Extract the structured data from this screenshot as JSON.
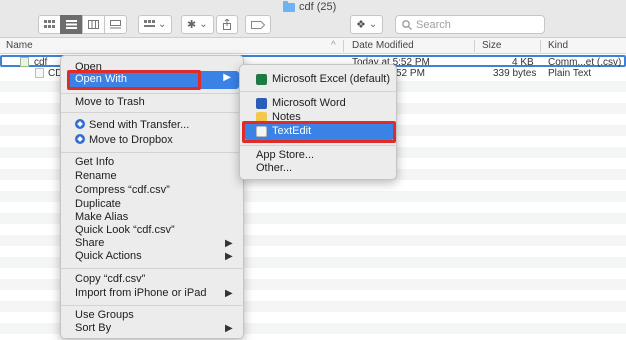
{
  "window": {
    "title": "cdf (25)"
  },
  "toolbar": {
    "view_icons": [
      "icon-view-icon",
      "list-view-icon",
      "column-view-icon",
      "gallery-view-icon"
    ],
    "group_caret": "⌄",
    "action_caret": "⌄",
    "dropbox_caret": "⌄",
    "search_placeholder": "Search"
  },
  "columns": {
    "name": "Name",
    "date": "Date Modified",
    "size": "Size",
    "kind": "Kind"
  },
  "files": [
    {
      "name": "cdf",
      "date": "Today at 5:52 PM",
      "size": "4 KB",
      "kind": "Comm...et (.csv)"
    },
    {
      "name": "CD",
      "date": "52 PM",
      "size": "339 bytes",
      "kind": "Plain Text"
    }
  ],
  "context_menu": {
    "open": "Open",
    "open_with": "Open With",
    "move_to_trash": "Move to Trash",
    "send_with_transfer": "Send with Transfer...",
    "move_to_dropbox": "Move to Dropbox",
    "get_info": "Get Info",
    "rename": "Rename",
    "compress": "Compress “cdf.csv”",
    "duplicate": "Duplicate",
    "make_alias": "Make Alias",
    "quick_look": "Quick Look “cdf.csv”",
    "share": "Share",
    "quick_actions": "Quick Actions",
    "copy": "Copy “cdf.csv”",
    "import_iphone": "Import from iPhone or iPad",
    "use_groups": "Use Groups",
    "sort_by": "Sort By"
  },
  "open_with_menu": {
    "excel": "Microsoft Excel (default)",
    "word": "Microsoft Word",
    "notes": "Notes",
    "textedit": "TextEdit",
    "app_store": "App Store...",
    "other": "Other..."
  },
  "colors": {
    "highlight": "#3a82e6",
    "annotation": "#e02b2b",
    "excel": "#1f7a43",
    "word": "#2b5cb8",
    "notes": "#f2c94c"
  }
}
